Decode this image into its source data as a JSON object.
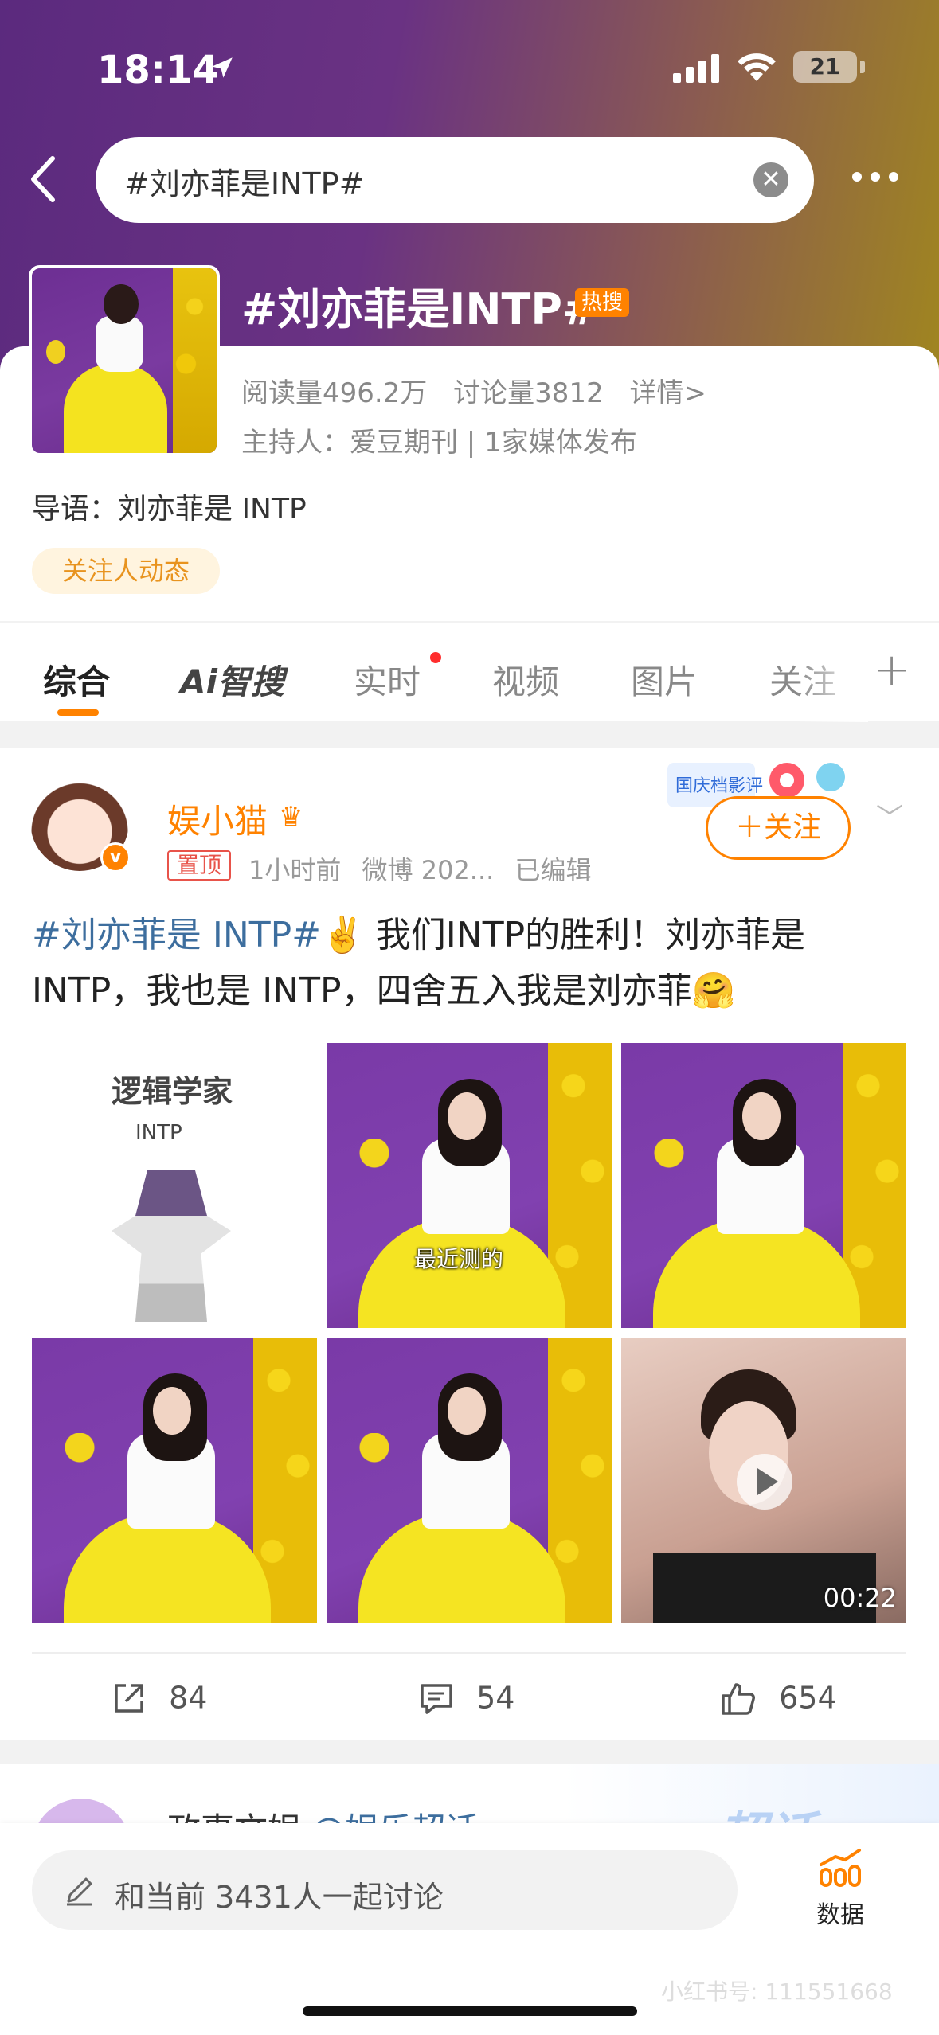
{
  "status_bar": {
    "time": "18:14",
    "battery": "21"
  },
  "search": {
    "query": "#刘亦菲是INTP#"
  },
  "topic": {
    "title": "#刘亦菲是INTP#",
    "hot_badge": "热搜",
    "reads": "阅读量496.2万",
    "discussions": "讨论量3812",
    "details": "详情>",
    "host": "主持人：爱豆期刊 | 1家媒体发布",
    "intro": "导语：刘亦菲是 INTP",
    "follow_chip": "关注人动态"
  },
  "tabs": [
    {
      "label": "综合",
      "active": true
    },
    {
      "label": "Ai智搜"
    },
    {
      "label": "实时"
    },
    {
      "label": "视频"
    },
    {
      "label": "图片"
    },
    {
      "label": "关注"
    }
  ],
  "post": {
    "username": "娱小猫",
    "pinned": "置顶",
    "time": "1小时前",
    "source": "微博 202...",
    "edited": "已编辑",
    "follow_label": "＋关注",
    "sticker_text": "国庆档影评",
    "text_tag": "#刘亦菲是 INTP#",
    "text_body": "✌️ 我们INTP的胜利！刘亦菲是INTP，我也是 INTP，四舍五入我是刘亦菲🤗",
    "image1_title": "逻辑学家",
    "image1_sub": "INTP",
    "image2_caption": "最近测的",
    "video_duration": "00:22",
    "shares": "84",
    "comments": "54",
    "likes": "654"
  },
  "next_post": {
    "name": "政事文娱",
    "sub": "@娱乐超话",
    "brand": "超话"
  },
  "bottom": {
    "discuss_text": "和当前 3431人一起讨论",
    "data_label": "数据",
    "watermark": "小红书号: 111551668"
  },
  "colors": {
    "accent": "#ff8200",
    "link": "#3d6e9e"
  }
}
